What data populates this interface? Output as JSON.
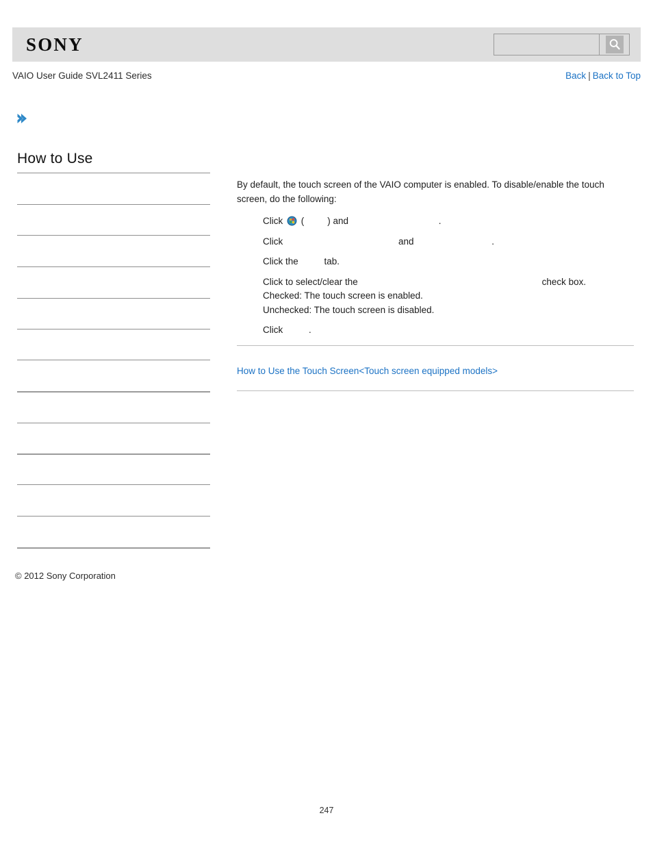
{
  "header": {
    "logo_text": "SONY",
    "search": {
      "value": "",
      "placeholder": "",
      "button_icon": "search-icon"
    }
  },
  "title_bar": {
    "guide_title": "VAIO User Guide SVL2411 Series",
    "back_label": "Back",
    "separator": "|",
    "back_to_top_label": "Back to Top"
  },
  "sidebar": {
    "chevron_icon": "chevron-right-icon",
    "heading": "How to Use",
    "items": [
      {
        "label": ""
      },
      {
        "label": ""
      },
      {
        "label": ""
      },
      {
        "label": ""
      },
      {
        "label": ""
      },
      {
        "label": ""
      },
      {
        "label": ""
      },
      {
        "label": ""
      },
      {
        "label": ""
      },
      {
        "label": ""
      },
      {
        "label": ""
      },
      {
        "label": ""
      },
      {
        "label": ""
      }
    ]
  },
  "main": {
    "intro": "By default, the touch screen of the VAIO computer is enabled. To disable/enable the touch screen, do the following:",
    "steps": [
      {
        "id": "step-start-orb",
        "icon": "windows-start-orb-icon",
        "prefix": "Click ",
        "mid1": " (",
        "mid2": ") and ",
        "suffix": "."
      },
      {
        "id": "step-click-and",
        "prefix": "Click ",
        "mid1": "and ",
        "suffix": "."
      },
      {
        "id": "step-click-tab",
        "prefix": "Click the ",
        "suffix": "tab."
      },
      {
        "id": "step-checkbox",
        "prefix": "Click to select/clear the ",
        "suffix": "check box.",
        "sub_checked": "Checked: The touch screen is enabled.",
        "sub_unchecked": "Unchecked: The touch screen is disabled."
      },
      {
        "id": "step-final-click",
        "prefix": "Click ",
        "suffix": "."
      }
    ],
    "related_link": "How to Use the Touch Screen<Touch screen equipped models>"
  },
  "footer": {
    "copyright": "© 2012 Sony Corporation",
    "page_number": "247"
  },
  "colors": {
    "header_band": "#dedede",
    "link_blue": "#1b72c4",
    "chevron_blue": "#2f89c8",
    "rule_gray": "#8f8f8f"
  }
}
